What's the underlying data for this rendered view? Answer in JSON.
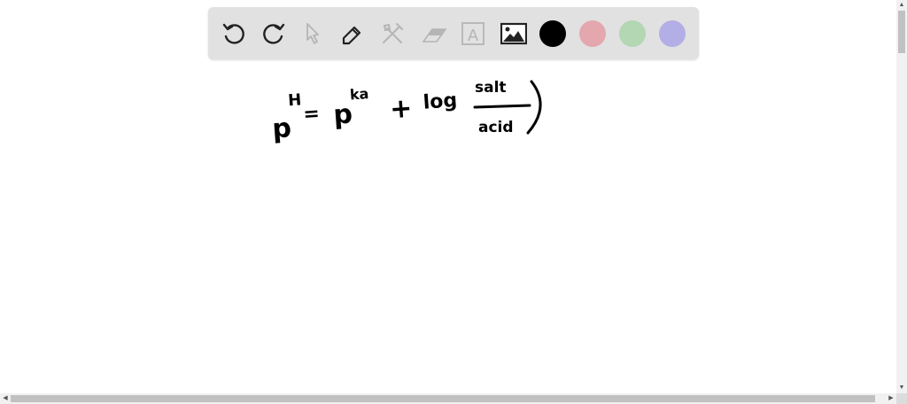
{
  "toolbar": {
    "tools": [
      {
        "icon": "undo-icon"
      },
      {
        "icon": "redo-icon"
      },
      {
        "icon": "pointer-icon"
      },
      {
        "icon": "pencil-icon"
      },
      {
        "icon": "tools-icon"
      },
      {
        "icon": "eraser-icon"
      },
      {
        "icon": "text-icon",
        "label": "A"
      },
      {
        "icon": "image-icon"
      }
    ],
    "colors": [
      "#000000",
      "#e4a7ae",
      "#b3d6b3",
      "#b3aee6"
    ]
  },
  "canvas": {
    "handwriting": {
      "p1": "p",
      "h": "H",
      "eq": "=",
      "p2": "p",
      "ka": "ka",
      "plus": "+",
      "log": "log",
      "numerator": "salt",
      "denominator": "acid"
    }
  }
}
